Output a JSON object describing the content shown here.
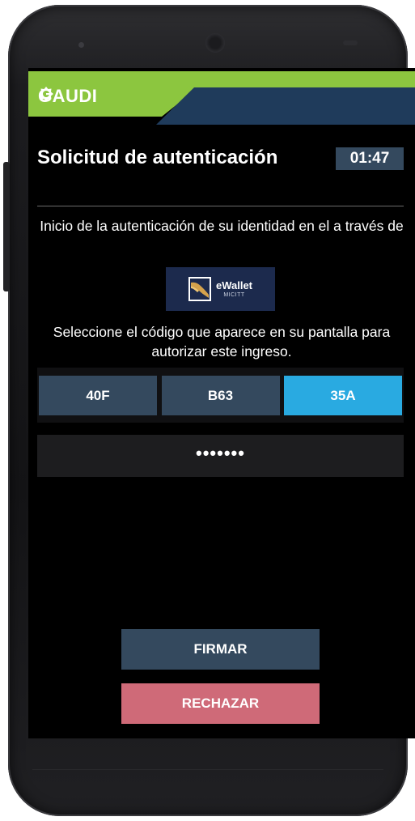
{
  "app": {
    "brand": "GAUDI",
    "brand_color": "#8cc63f",
    "header_color": "#1f3b5b"
  },
  "auth": {
    "title": "Solicitud de autenticación",
    "timer": "01:47",
    "intro": "Inicio de la autenticación de su identidad en el  a través de",
    "wallet_name": "eWallet",
    "wallet_sub": "MICITT",
    "instruction": "Seleccione el código que aparece en su pantalla para autorizar este ingreso.",
    "codes": [
      "40F",
      "B63",
      "35A"
    ],
    "selected_code": "35A",
    "pin_value": "•••••••",
    "sign_label": "FIRMAR",
    "reject_label": "RECHAZAR"
  },
  "colors": {
    "primary": "#34495e",
    "selected": "#29aae1",
    "reject": "#cf6a78"
  }
}
